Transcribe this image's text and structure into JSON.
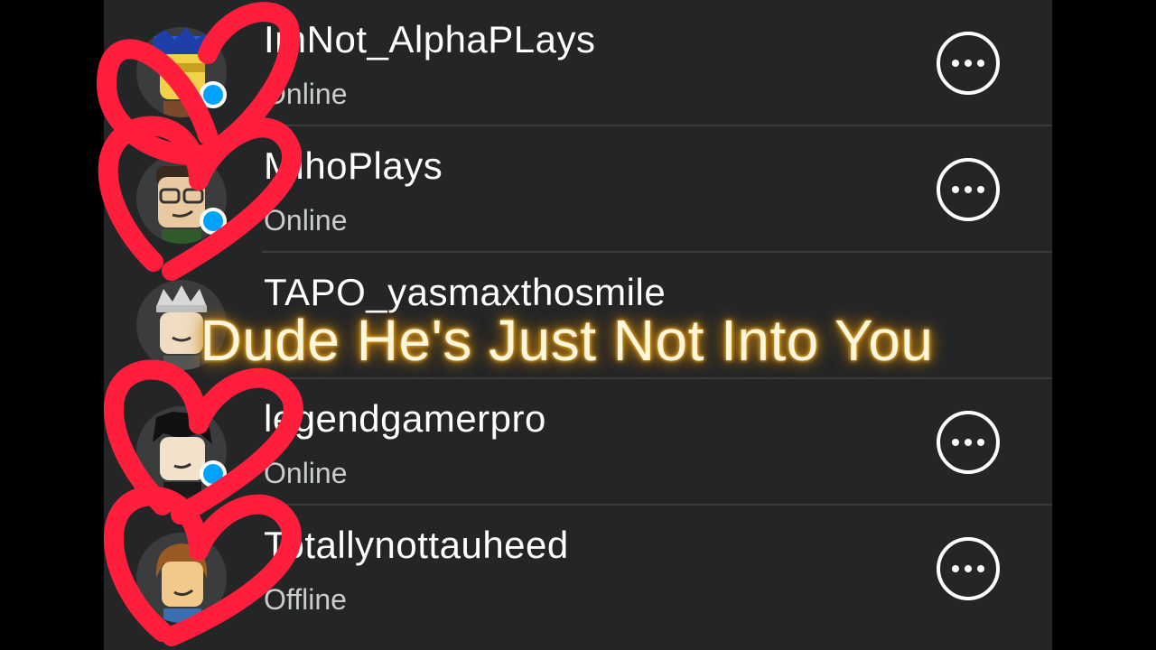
{
  "friends": [
    {
      "username": "ImNot_AlphaPLays",
      "status": "Online",
      "avatar_icon": "roblox-avatar-blue-hair-icon",
      "presence": "online"
    },
    {
      "username": "MihoPlays",
      "status": "Online",
      "avatar_icon": "roblox-avatar-glasses-icon",
      "presence": "online"
    },
    {
      "username": "TAPO_yasmaxthosmile",
      "status": "",
      "avatar_icon": "roblox-avatar-crown-icon",
      "presence": "online"
    },
    {
      "username": "legendgamerpro",
      "status": "Online",
      "avatar_icon": "roblox-avatar-black-hair-icon",
      "presence": "online"
    },
    {
      "username": "Totallynottauheed",
      "status": "Offline",
      "avatar_icon": "roblox-avatar-brown-hair-icon",
      "presence": "offline"
    }
  ],
  "more_button_icon": "more-options-icon",
  "caption": "Dude He's Just Not Into You",
  "colors": {
    "background": "#000000",
    "panel": "#232527",
    "separator": "#393b3d",
    "text_primary": "#ffffff",
    "text_secondary": "#c9cbcc",
    "presence_online": "#00a2ff",
    "heart_scribble": "#ff1e3c",
    "caption_glow": "#e0a020"
  }
}
